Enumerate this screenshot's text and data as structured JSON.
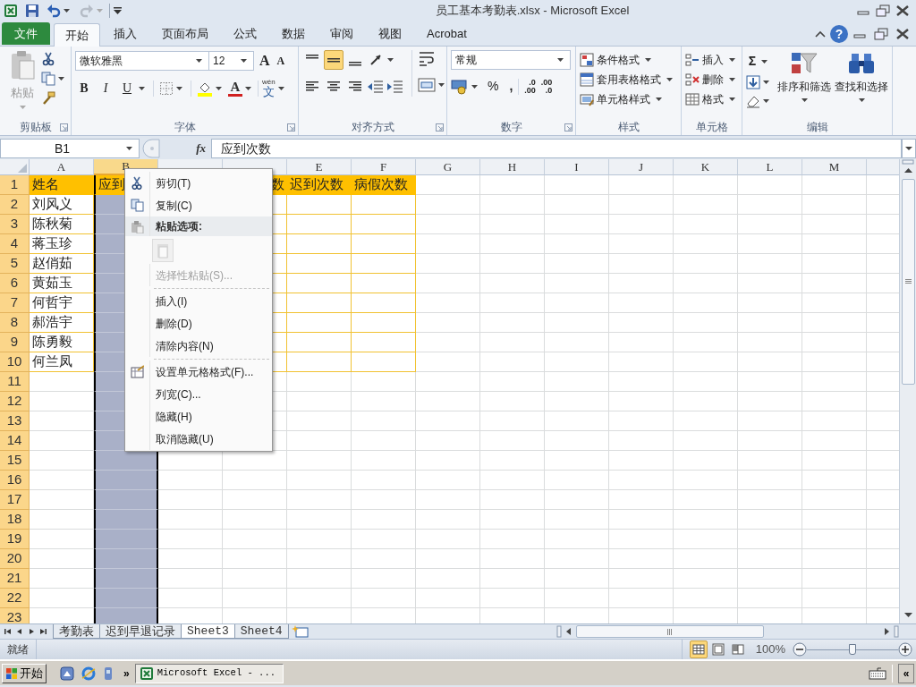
{
  "window": {
    "title": "员工基本考勤表.xlsx  -  Microsoft Excel",
    "help": "?"
  },
  "file_menu": "文件",
  "ribbon_tabs": [
    {
      "label": "开始",
      "selected": true
    },
    {
      "label": "插入",
      "selected": false
    },
    {
      "label": "页面布局",
      "selected": false
    },
    {
      "label": "公式",
      "selected": false
    },
    {
      "label": "数据",
      "selected": false
    },
    {
      "label": "审阅",
      "selected": false
    },
    {
      "label": "视图",
      "selected": false
    },
    {
      "label": "Acrobat",
      "selected": false
    }
  ],
  "ribbon": {
    "clipboard": {
      "title": "剪贴板",
      "paste": "粘贴"
    },
    "font": {
      "title": "字体",
      "font_name": "微软雅黑",
      "font_size": "12",
      "grow": "A",
      "shrink": "A",
      "styles": [
        "B",
        "I",
        "U"
      ],
      "font_color": "A",
      "phonetic": "文",
      "phonetic_ruby": "wén"
    },
    "alignment": {
      "title": "对齐方式",
      "vertical": [
        {
          "selected": false
        },
        {
          "selected": true
        },
        {
          "selected": false
        }
      ]
    },
    "number": {
      "title": "数字",
      "format": "常规",
      "percent": "%",
      "comma": ",",
      "decimals": [
        [
          ".0",
          ".00"
        ],
        [
          ".00",
          ".0"
        ]
      ]
    },
    "styles": {
      "title": "样式",
      "items": [
        "条件格式",
        "套用表格格式",
        "单元格样式"
      ]
    },
    "cells": {
      "title": "单元格",
      "items": [
        "插入",
        "删除",
        "格式"
      ]
    },
    "editing": {
      "title": "编辑",
      "sum": "Σ",
      "items": [
        "排序和筛选",
        "查找和选择"
      ]
    }
  },
  "formula_bar": {
    "name_box": "B1",
    "fx": "fx",
    "value": "应到次数"
  },
  "sheet": {
    "columns": [
      {
        "label": "A",
        "selected": false
      },
      {
        "label": "B",
        "selected": true
      },
      {
        "selected": false
      },
      {
        "selected": false
      },
      {
        "label": "E",
        "selected": false
      },
      {
        "label": "F",
        "selected": false
      },
      {
        "label": "G",
        "selected": false
      },
      {
        "label": "H",
        "selected": false
      },
      {
        "label": "I",
        "selected": false
      },
      {
        "label": "J",
        "selected": false
      },
      {
        "label": "K",
        "selected": false
      },
      {
        "label": "L",
        "selected": false
      },
      {
        "label": "M",
        "selected": false
      }
    ],
    "rows": [
      {
        "label": "1",
        "header": true,
        "bordered": true,
        "cells": {
          "A": "姓名",
          "B": "应到",
          "D": "数",
          "E": "迟到次数",
          "F": "病假次数"
        }
      },
      {
        "label": "2",
        "header": false,
        "bordered": true,
        "cells": {
          "A": "刘风义"
        }
      },
      {
        "label": "3",
        "header": false,
        "bordered": true,
        "cells": {
          "A": "陈秋菊"
        }
      },
      {
        "label": "4",
        "header": false,
        "bordered": true,
        "cells": {
          "A": "蒋玉珍"
        }
      },
      {
        "label": "5",
        "header": false,
        "bordered": true,
        "cells": {
          "A": "赵俏茹"
        }
      },
      {
        "label": "6",
        "header": false,
        "bordered": true,
        "cells": {
          "A": "黄茹玉"
        }
      },
      {
        "label": "7",
        "header": false,
        "bordered": true,
        "cells": {
          "A": "何哲宇"
        }
      },
      {
        "label": "8",
        "header": false,
        "bordered": true,
        "cells": {
          "A": "郝浩宇"
        }
      },
      {
        "label": "9",
        "header": false,
        "bordered": true,
        "cells": {
          "A": "陈勇毅"
        }
      },
      {
        "label": "10",
        "header": false,
        "bordered": true,
        "cells": {
          "A": "何兰凤"
        }
      },
      {
        "label": "11",
        "header": false,
        "bordered": false
      },
      {
        "label": "12",
        "header": false,
        "bordered": false
      },
      {
        "label": "13",
        "header": false,
        "bordered": false
      },
      {
        "label": "14",
        "header": false,
        "bordered": false
      },
      {
        "label": "15",
        "header": false,
        "bordered": false
      },
      {
        "label": "16",
        "header": false,
        "bordered": false
      },
      {
        "label": "17",
        "header": false,
        "bordered": false
      },
      {
        "label": "18",
        "header": false,
        "bordered": false
      },
      {
        "label": "19",
        "header": false,
        "bordered": false
      },
      {
        "label": "20",
        "header": false,
        "bordered": false
      },
      {
        "label": "21",
        "header": false,
        "bordered": false
      },
      {
        "label": "22",
        "header": false,
        "bordered": false
      },
      {
        "label": "23",
        "header": false,
        "bordered": false
      }
    ]
  },
  "context_menu": [
    {
      "kind": "cut",
      "label": "剪切(T)",
      "disabled": false
    },
    {
      "kind": "copy",
      "label": "复制(C)",
      "disabled": false
    },
    {
      "kind": "header",
      "label": "粘贴选项:"
    },
    {
      "kind": "paste_button",
      "disabled": true
    },
    {
      "kind": "item",
      "label": "选择性粘贴(S)...",
      "disabled": true
    },
    {
      "kind": "separator"
    },
    {
      "kind": "item",
      "label": "插入(I)",
      "disabled": false
    },
    {
      "kind": "item",
      "label": "删除(D)",
      "disabled": false
    },
    {
      "kind": "item",
      "label": "清除内容(N)",
      "disabled": false
    },
    {
      "kind": "separator"
    },
    {
      "kind": "format",
      "label": "设置单元格格式(F)...",
      "disabled": false
    },
    {
      "kind": "item",
      "label": "列宽(C)...",
      "disabled": false
    },
    {
      "kind": "item",
      "label": "隐藏(H)",
      "disabled": false
    },
    {
      "kind": "item",
      "label": "取消隐藏(U)",
      "disabled": false
    }
  ],
  "sheet_tabs": [
    {
      "label": "考勤表",
      "selected": false
    },
    {
      "label": "迟到早退记录",
      "selected": false
    },
    {
      "label": "Sheet3",
      "selected": true
    },
    {
      "label": "Sheet4",
      "selected": false
    }
  ],
  "status_bar": {
    "status": "就绪",
    "view_modes": [
      {
        "kind": "normal",
        "selected": true
      },
      {
        "kind": "layout",
        "selected": false
      },
      {
        "kind": "pagebreak",
        "selected": false
      }
    ],
    "zoom": "100%",
    "zoom_slider": {
      "level": 0.5
    }
  },
  "taskbar": {
    "start": "开始",
    "chevron": "»",
    "tasks": [
      {
        "label": "Microsoft Excel - ...",
        "selected": true
      }
    ],
    "tray_chevron": "«"
  }
}
